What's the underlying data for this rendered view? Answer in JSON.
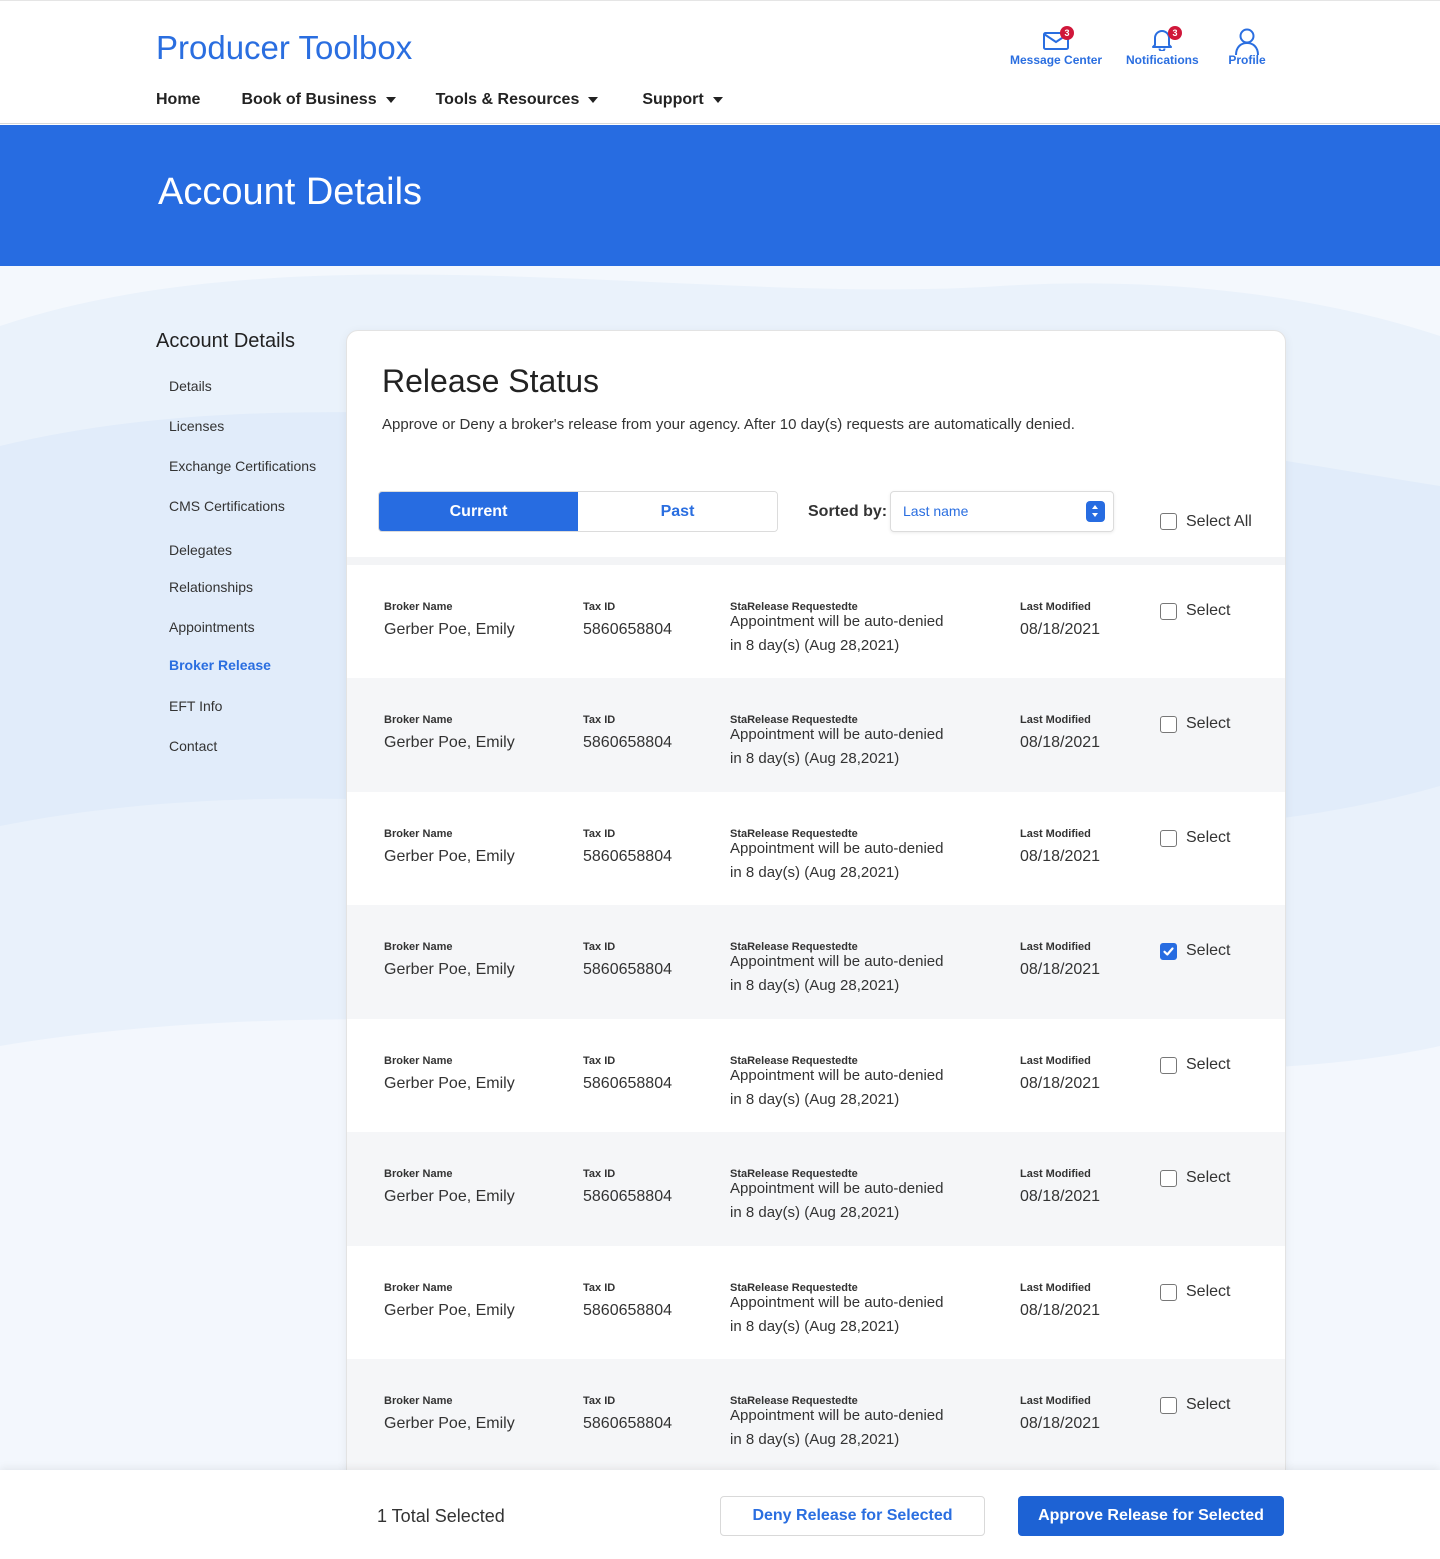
{
  "app": {
    "brand": "Producer Toolbox"
  },
  "nav": {
    "home": "Home",
    "book_of_business": "Book of Business",
    "tools_resources": "Tools & Resources",
    "support": "Support"
  },
  "header_icons": {
    "messages": {
      "label": "Message Center",
      "badge": "3"
    },
    "notifications": {
      "label": "Notifications",
      "badge": "3"
    },
    "profile": {
      "label": "Profile"
    }
  },
  "banner": {
    "title": "Account Details"
  },
  "sidebar": {
    "title": "Account Details",
    "items": [
      "Details",
      "Licenses",
      "Exchange Certifications",
      "CMS Certifications",
      "Delegates",
      "Relationships",
      "Appointments",
      "Broker Release",
      "EFT Info",
      "Contact"
    ],
    "active": "Broker Release"
  },
  "release": {
    "title": "Release Status",
    "description": "Approve or Deny a broker's release from your agency. After 10 day(s) requests are automatically denied.",
    "tabs": [
      "Current",
      "Past"
    ],
    "active_tab": "Current",
    "sort_label": "Sorted by:",
    "sort_value": "Last name",
    "select_all_label": "Select All",
    "columns": {
      "broker": "Broker Name",
      "tax": "Tax ID",
      "status": "StaRelease Requestedte",
      "modified": "Last Modified"
    },
    "select_label": "Select",
    "rows": [
      {
        "broker": "Gerber Poe, Emily",
        "tax": "5860658804",
        "status_line1": "Appointment will be auto-denied",
        "status_line2": "in 8 day(s) (Aug 28,2021)",
        "modified": "08/18/2021",
        "checked": false
      },
      {
        "broker": "Gerber Poe, Emily",
        "tax": "5860658804",
        "status_line1": "Appointment will be auto-denied",
        "status_line2": "in 8 day(s) (Aug 28,2021)",
        "modified": "08/18/2021",
        "checked": false
      },
      {
        "broker": "Gerber Poe, Emily",
        "tax": "5860658804",
        "status_line1": "Appointment will be auto-denied",
        "status_line2": "in 8 day(s) (Aug 28,2021)",
        "modified": "08/18/2021",
        "checked": false
      },
      {
        "broker": "Gerber Poe, Emily",
        "tax": "5860658804",
        "status_line1": "Appointment will be auto-denied",
        "status_line2": "in 8 day(s) (Aug 28,2021)",
        "modified": "08/18/2021",
        "checked": true
      },
      {
        "broker": "Gerber Poe, Emily",
        "tax": "5860658804",
        "status_line1": "Appointment will be auto-denied",
        "status_line2": "in 8 day(s) (Aug 28,2021)",
        "modified": "08/18/2021",
        "checked": false
      },
      {
        "broker": "Gerber Poe, Emily",
        "tax": "5860658804",
        "status_line1": "Appointment will be auto-denied",
        "status_line2": "in 8 day(s) (Aug 28,2021)",
        "modified": "08/18/2021",
        "checked": false
      },
      {
        "broker": "Gerber Poe, Emily",
        "tax": "5860658804",
        "status_line1": "Appointment will be auto-denied",
        "status_line2": "in 8 day(s) (Aug 28,2021)",
        "modified": "08/18/2021",
        "checked": false
      },
      {
        "broker": "Gerber Poe, Emily",
        "tax": "5860658804",
        "status_line1": "Appointment will be auto-denied",
        "status_line2": "in 8 day(s) (Aug 28,2021)",
        "modified": "08/18/2021",
        "checked": false
      }
    ]
  },
  "footer": {
    "total_selected": "1 Total Selected",
    "deny_label": "Deny Release for Selected",
    "approve_label": "Approve Release for Selected"
  },
  "colors": {
    "accent": "#276ce1",
    "brand_text": "#2a6ee0",
    "badge": "#d0173a"
  }
}
